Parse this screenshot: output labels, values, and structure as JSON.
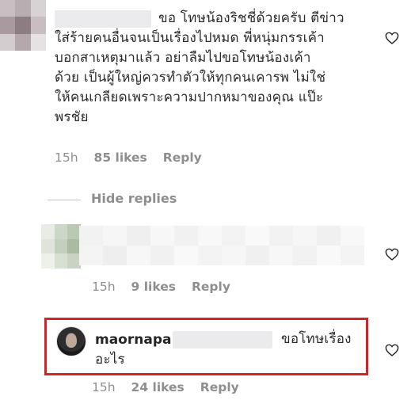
{
  "comments": [
    {
      "text_lines": [
        "ขอ โทษน้องริชชี่ด้วยครับ ตีข่าว",
        "ใส่ร้ายคนอื่นจนเป็นเรื่องไปหมด พี่หนุ่มกรรเค้า",
        "บอกสาเหตุมาแล้ว อย่าลืมไปขอโทษน้องเค้า",
        "ด้วย เป็นผู้ใหญ่ควรทำตัวให้ทุกคนเคารพ ไม่ใช่",
        "ให้คนเกลียดเพราะความปากหมาของคุณ แป๊ะ",
        "พรชัย"
      ],
      "time": "15h",
      "likes": "85 likes",
      "reply": "Reply"
    }
  ],
  "hide_replies": "Hide replies",
  "replies": [
    {
      "time": "15h",
      "likes": "9 likes",
      "reply": "Reply"
    },
    {
      "username": "maornapa",
      "text_part1": "ขอโทษเรื่อง",
      "text_part2": "อะไร",
      "time": "15h",
      "likes": "24 likes",
      "reply": "Reply"
    }
  ],
  "colors": {
    "highlight": "#d1232a",
    "meta": "#8e8e8e",
    "text": "#262626"
  },
  "icons": [
    "heart-outline-icon"
  ]
}
